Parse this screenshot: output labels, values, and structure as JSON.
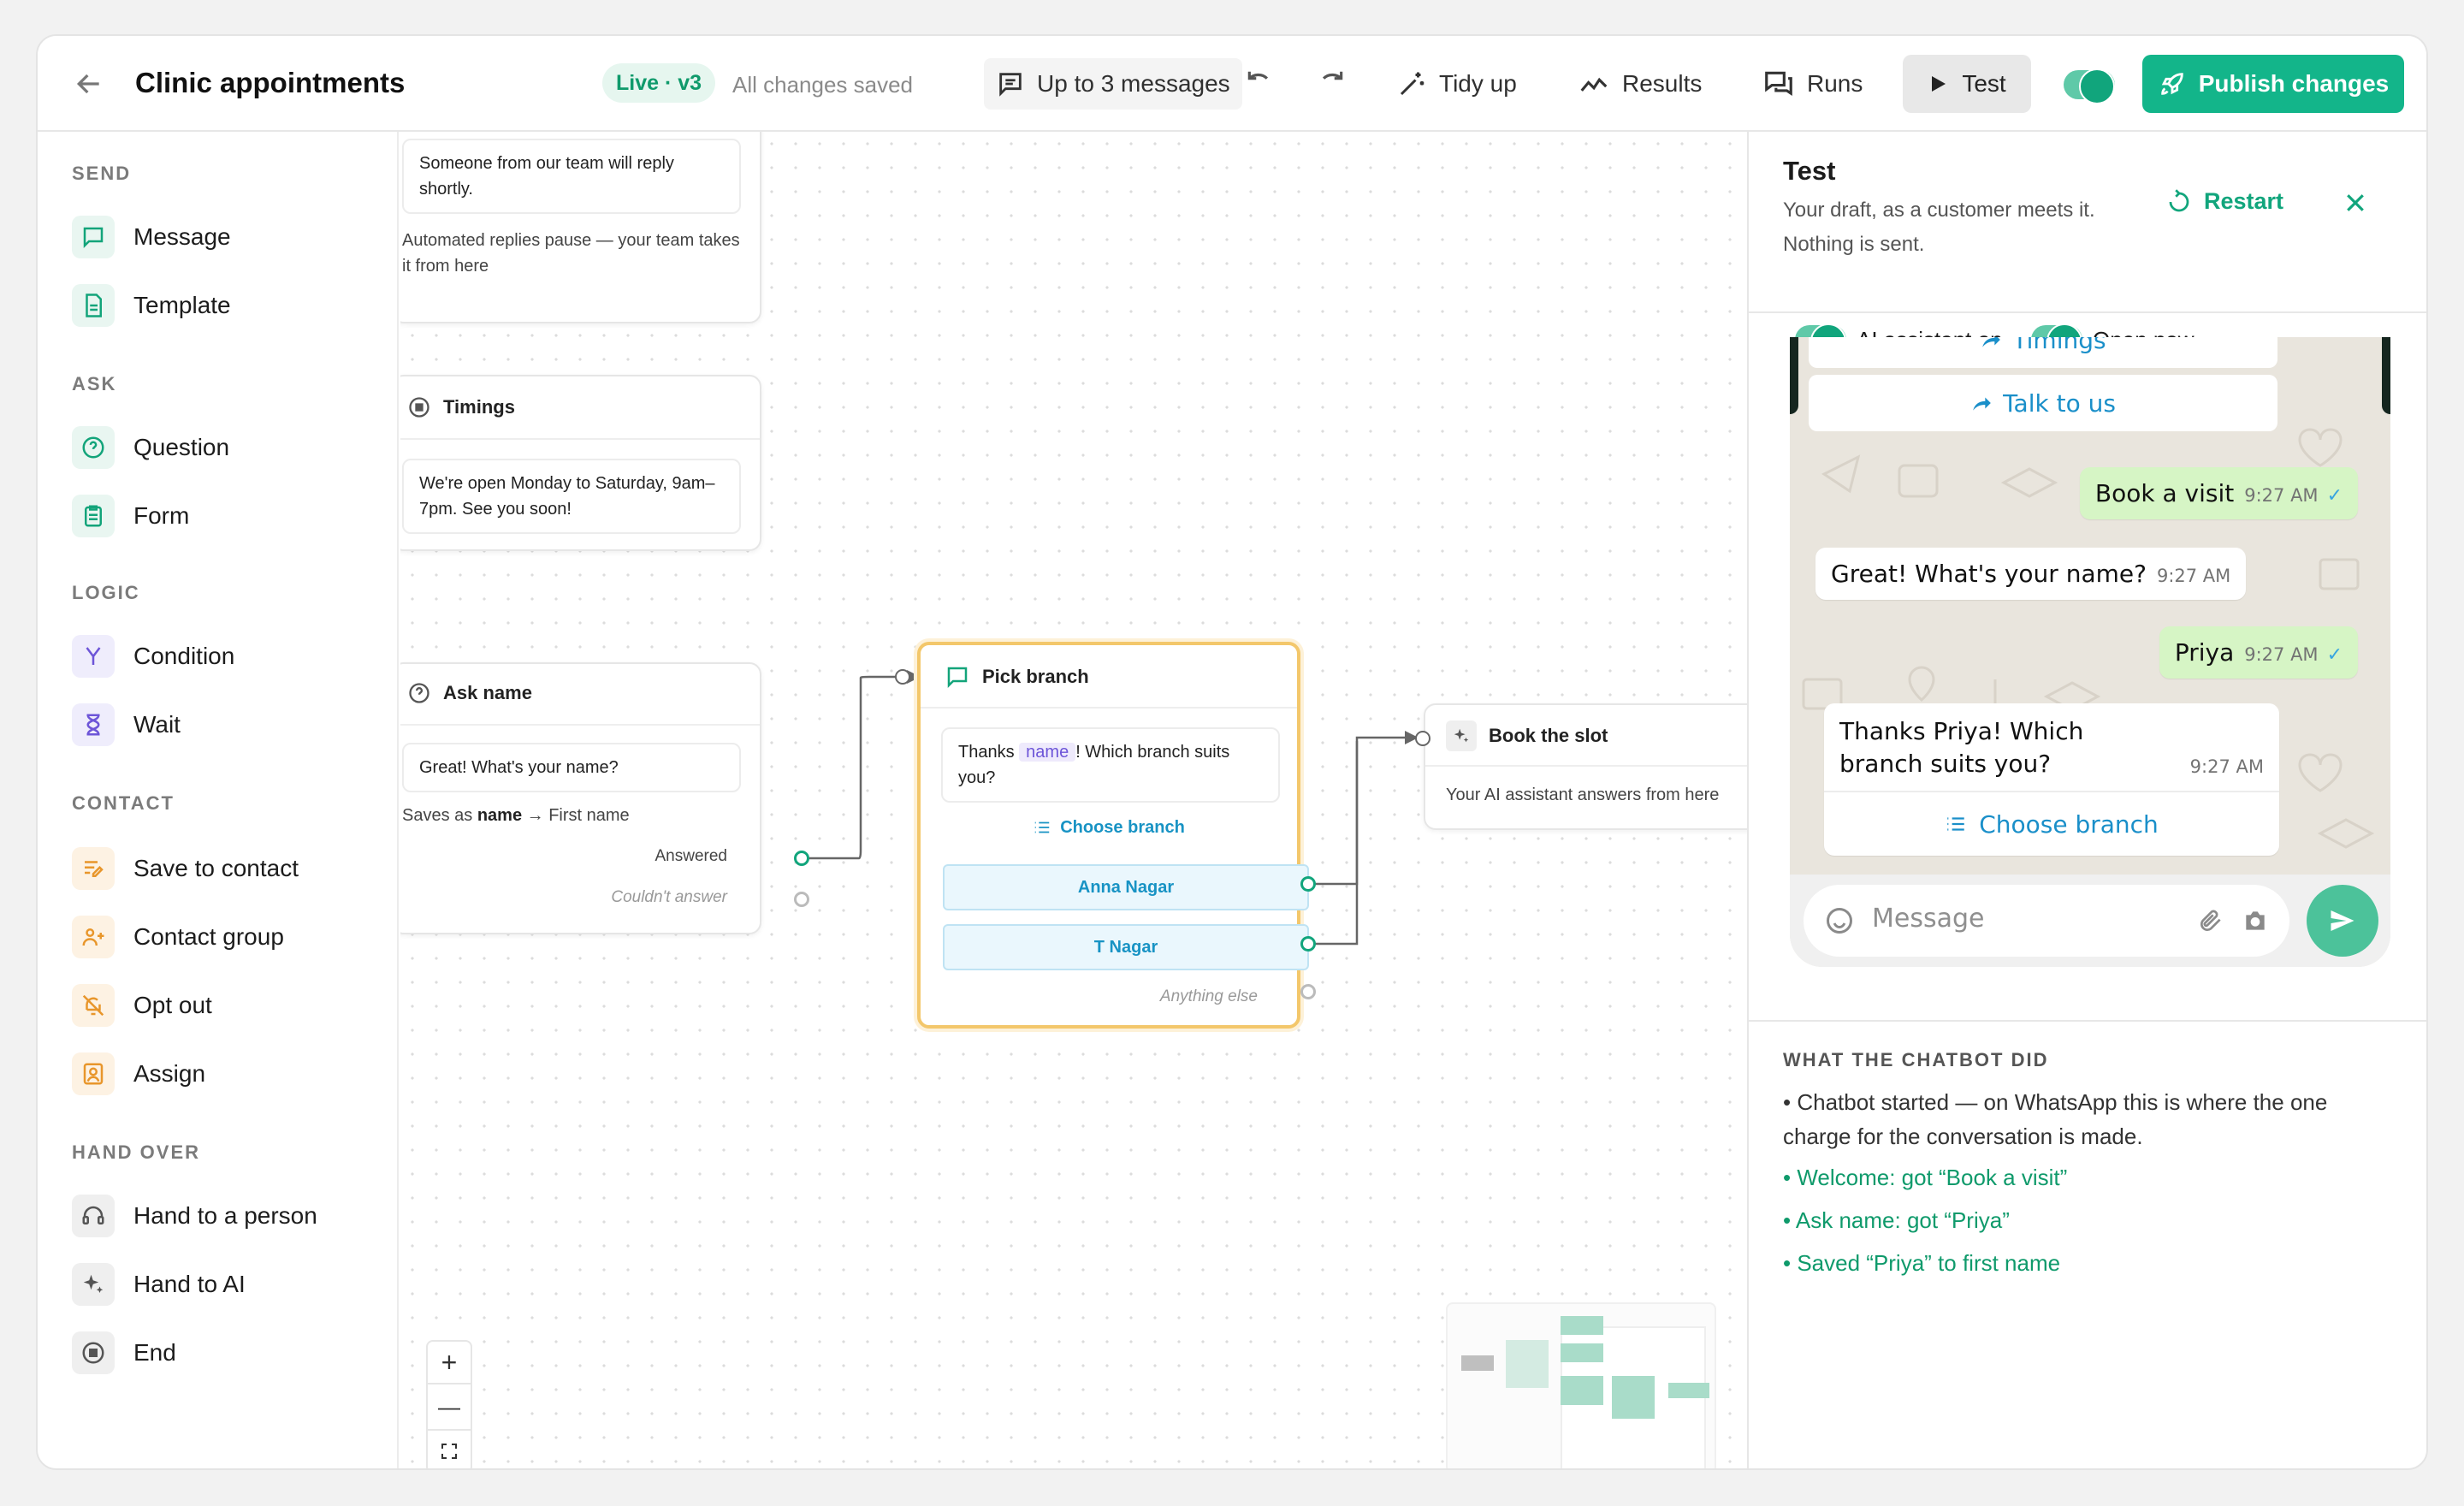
{
  "header": {
    "title": "Clinic appointments",
    "badge": "Live · v3",
    "save_status": "All changes saved",
    "messages_limit": "Up to 3 messages",
    "tidy": "Tidy up",
    "results": "Results",
    "runs": "Runs",
    "test": "Test",
    "publish": "Publish changes"
  },
  "sidebar": {
    "send": {
      "title": "SEND",
      "items": [
        "Message",
        "Template"
      ]
    },
    "ask": {
      "title": "ASK",
      "items": [
        "Question",
        "Form"
      ]
    },
    "logic": {
      "title": "LOGIC",
      "items": [
        "Condition",
        "Wait"
      ]
    },
    "contact": {
      "title": "CONTACT",
      "items": [
        "Save to contact",
        "Contact group",
        "Opt out",
        "Assign"
      ]
    },
    "handover": {
      "title": "HAND OVER",
      "items": [
        "Hand to a person",
        "Hand to AI",
        "End"
      ]
    }
  },
  "canvas": {
    "handoff_node": {
      "text": "Someone from our team will reply shortly.",
      "note": "Automated replies pause — your team takes it from here"
    },
    "timings_node": {
      "title": "Timings",
      "text": "We're open Monday to Saturday, 9am–7pm. See you soon!"
    },
    "ask_name_node": {
      "title": "Ask name",
      "text": "Great! What's your name?",
      "saves_prefix": "Saves as",
      "saves_var": "name",
      "saves_suffix": "→ First name",
      "answered": "Answered",
      "not_answered": "Couldn't answer"
    },
    "pick_branch_node": {
      "title": "Pick branch",
      "text_before": "Thanks",
      "var": "name",
      "text_after": "! Which branch suits you?",
      "list_label": "Choose branch",
      "options": [
        "Anna Nagar",
        "T Nagar"
      ],
      "fallback": "Anything else"
    },
    "book_node": {
      "title": "Book the slot",
      "text": "Your AI assistant answers from here"
    },
    "zoom": {
      "in": "+",
      "out": "—"
    }
  },
  "panel": {
    "title": "Test",
    "subtitle": "Your draft, as a customer meets it. Nothing is sent.",
    "restart": "Restart",
    "toggle_ai": "AI assistant on",
    "toggle_open": "Open now",
    "chat": {
      "buttons": [
        "Timings",
        "Talk to us"
      ],
      "messages": [
        {
          "from": "user",
          "text": "Book a visit",
          "time": "9:27 AM"
        },
        {
          "from": "bot",
          "text": "Great! What's your name?",
          "time": "9:27 AM"
        },
        {
          "from": "user",
          "text": "Priya",
          "time": "9:27 AM"
        },
        {
          "from": "bot",
          "text": "Thanks Priya! Which branch suits you?",
          "time": "9:27 AM"
        }
      ],
      "list_button": "Choose branch",
      "input_placeholder": "Message"
    },
    "log_title": "WHAT THE CHATBOT DID",
    "log": [
      "• Chatbot started — on WhatsApp this is where the one charge for the conversation is made.",
      "• Welcome: got “Book a visit”",
      "• Ask name: got “Priya”",
      "• Saved “Priya” to first name"
    ]
  },
  "colors": {
    "accent": "#13b58a",
    "selected_node": "#f3c76b",
    "link": "#1a8fc9"
  }
}
